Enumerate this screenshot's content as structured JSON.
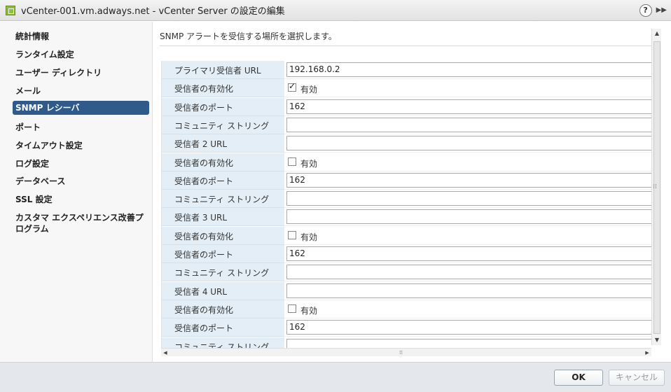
{
  "window": {
    "title": "vCenter-001.vm.adways.net - vCenter Server の設定の編集",
    "help_icon": "help-icon",
    "help_label": "?",
    "expand_label": "▶▶"
  },
  "sidebar": {
    "items": [
      {
        "label": "統計情報"
      },
      {
        "label": "ランタイム設定"
      },
      {
        "label": "ユーザー ディレクトリ"
      },
      {
        "label": "メール"
      },
      {
        "label": "SNMP レシーバ",
        "active": true
      },
      {
        "label": "ポート"
      },
      {
        "label": "タイムアウト設定"
      },
      {
        "label": "ログ設定"
      },
      {
        "label": "データベース"
      },
      {
        "label": "SSL 設定"
      },
      {
        "label": "カスタマ エクスペリエンス改善プログラム"
      }
    ]
  },
  "main": {
    "instruction": "SNMP アラートを受信する場所を選択します。",
    "rows": [
      {
        "label": "プライマリ受信者 URL",
        "type": "text",
        "value": "192.168.0.2"
      },
      {
        "label": "受信者の有効化",
        "type": "checkbox",
        "checked": true,
        "check_label": "有効"
      },
      {
        "label": "受信者のポート",
        "type": "text",
        "value": "162"
      },
      {
        "label": "コミュニティ ストリング",
        "type": "text",
        "value": ""
      },
      {
        "label": "受信者 2 URL",
        "type": "text",
        "value": ""
      },
      {
        "label": "受信者の有効化",
        "type": "checkbox",
        "checked": false,
        "check_label": "有効"
      },
      {
        "label": "受信者のポート",
        "type": "text",
        "value": "162"
      },
      {
        "label": "コミュニティ ストリング",
        "type": "text",
        "value": ""
      },
      {
        "label": "受信者 3 URL",
        "type": "text",
        "value": ""
      },
      {
        "label": "受信者の有効化",
        "type": "checkbox",
        "checked": false,
        "check_label": "有効"
      },
      {
        "label": "受信者のポート",
        "type": "text",
        "value": "162"
      },
      {
        "label": "コミュニティ ストリング",
        "type": "text",
        "value": ""
      },
      {
        "label": "受信者 4 URL",
        "type": "text",
        "value": ""
      },
      {
        "label": "受信者の有効化",
        "type": "checkbox",
        "checked": false,
        "check_label": "有効"
      },
      {
        "label": "受信者のポート",
        "type": "text",
        "value": "162"
      },
      {
        "label": "コミュニティ ストリング",
        "type": "text",
        "value": ""
      }
    ]
  },
  "footer": {
    "ok_label": "OK",
    "cancel_label": "キャンセル"
  },
  "colors": {
    "active_nav": "#2f5a8a",
    "label_cell": "#e3eef6",
    "footer": "#e4e7eb"
  }
}
